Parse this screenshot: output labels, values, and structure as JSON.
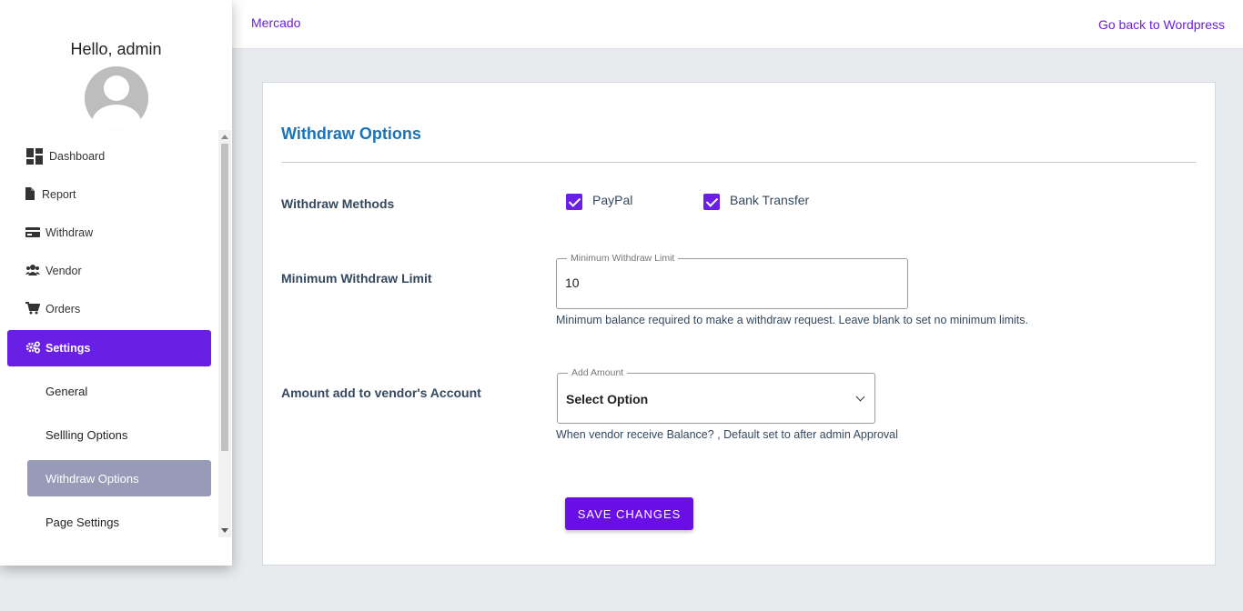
{
  "header": {
    "brand": "Mercado",
    "back_link": "Go back to Wordpress"
  },
  "sidebar": {
    "greeting": "Hello, admin",
    "items": [
      {
        "label": "Dashboard",
        "icon": "dashboard-icon"
      },
      {
        "label": "Report",
        "icon": "file-icon"
      },
      {
        "label": "Withdraw",
        "icon": "card-icon"
      },
      {
        "label": "Vendor",
        "icon": "users-icon"
      },
      {
        "label": "Orders",
        "icon": "cart-icon"
      },
      {
        "label": "Settings",
        "icon": "gears-icon",
        "active": true
      }
    ],
    "subitems": [
      {
        "label": "General"
      },
      {
        "label": "Sellling Options"
      },
      {
        "label": "Withdraw Options",
        "selected": true
      },
      {
        "label": "Page Settings"
      }
    ]
  },
  "main": {
    "title": "Withdraw Options",
    "withdraw_methods": {
      "label": "Withdraw Methods",
      "options": [
        {
          "label": "PayPal",
          "checked": true
        },
        {
          "label": "Bank Transfer",
          "checked": true
        }
      ]
    },
    "minimum_limit": {
      "label": "Minimum Withdraw Limit",
      "field_legend": "Minimum Withdraw Limit",
      "value": "10",
      "helper": "Minimum balance required to make a withdraw request. Leave blank to set no minimum limits."
    },
    "vendor_account": {
      "label": "Amount add to vendor's Account",
      "field_legend": "Add Amount",
      "selected": "Select Option",
      "helper": "When vendor receive Balance? , Default set to after admin Approval"
    },
    "save_label": "SAVE CHANGES"
  },
  "colors": {
    "accent": "#6a1fe4",
    "title": "#1a73b8",
    "selected_sub": "#979bb8"
  }
}
